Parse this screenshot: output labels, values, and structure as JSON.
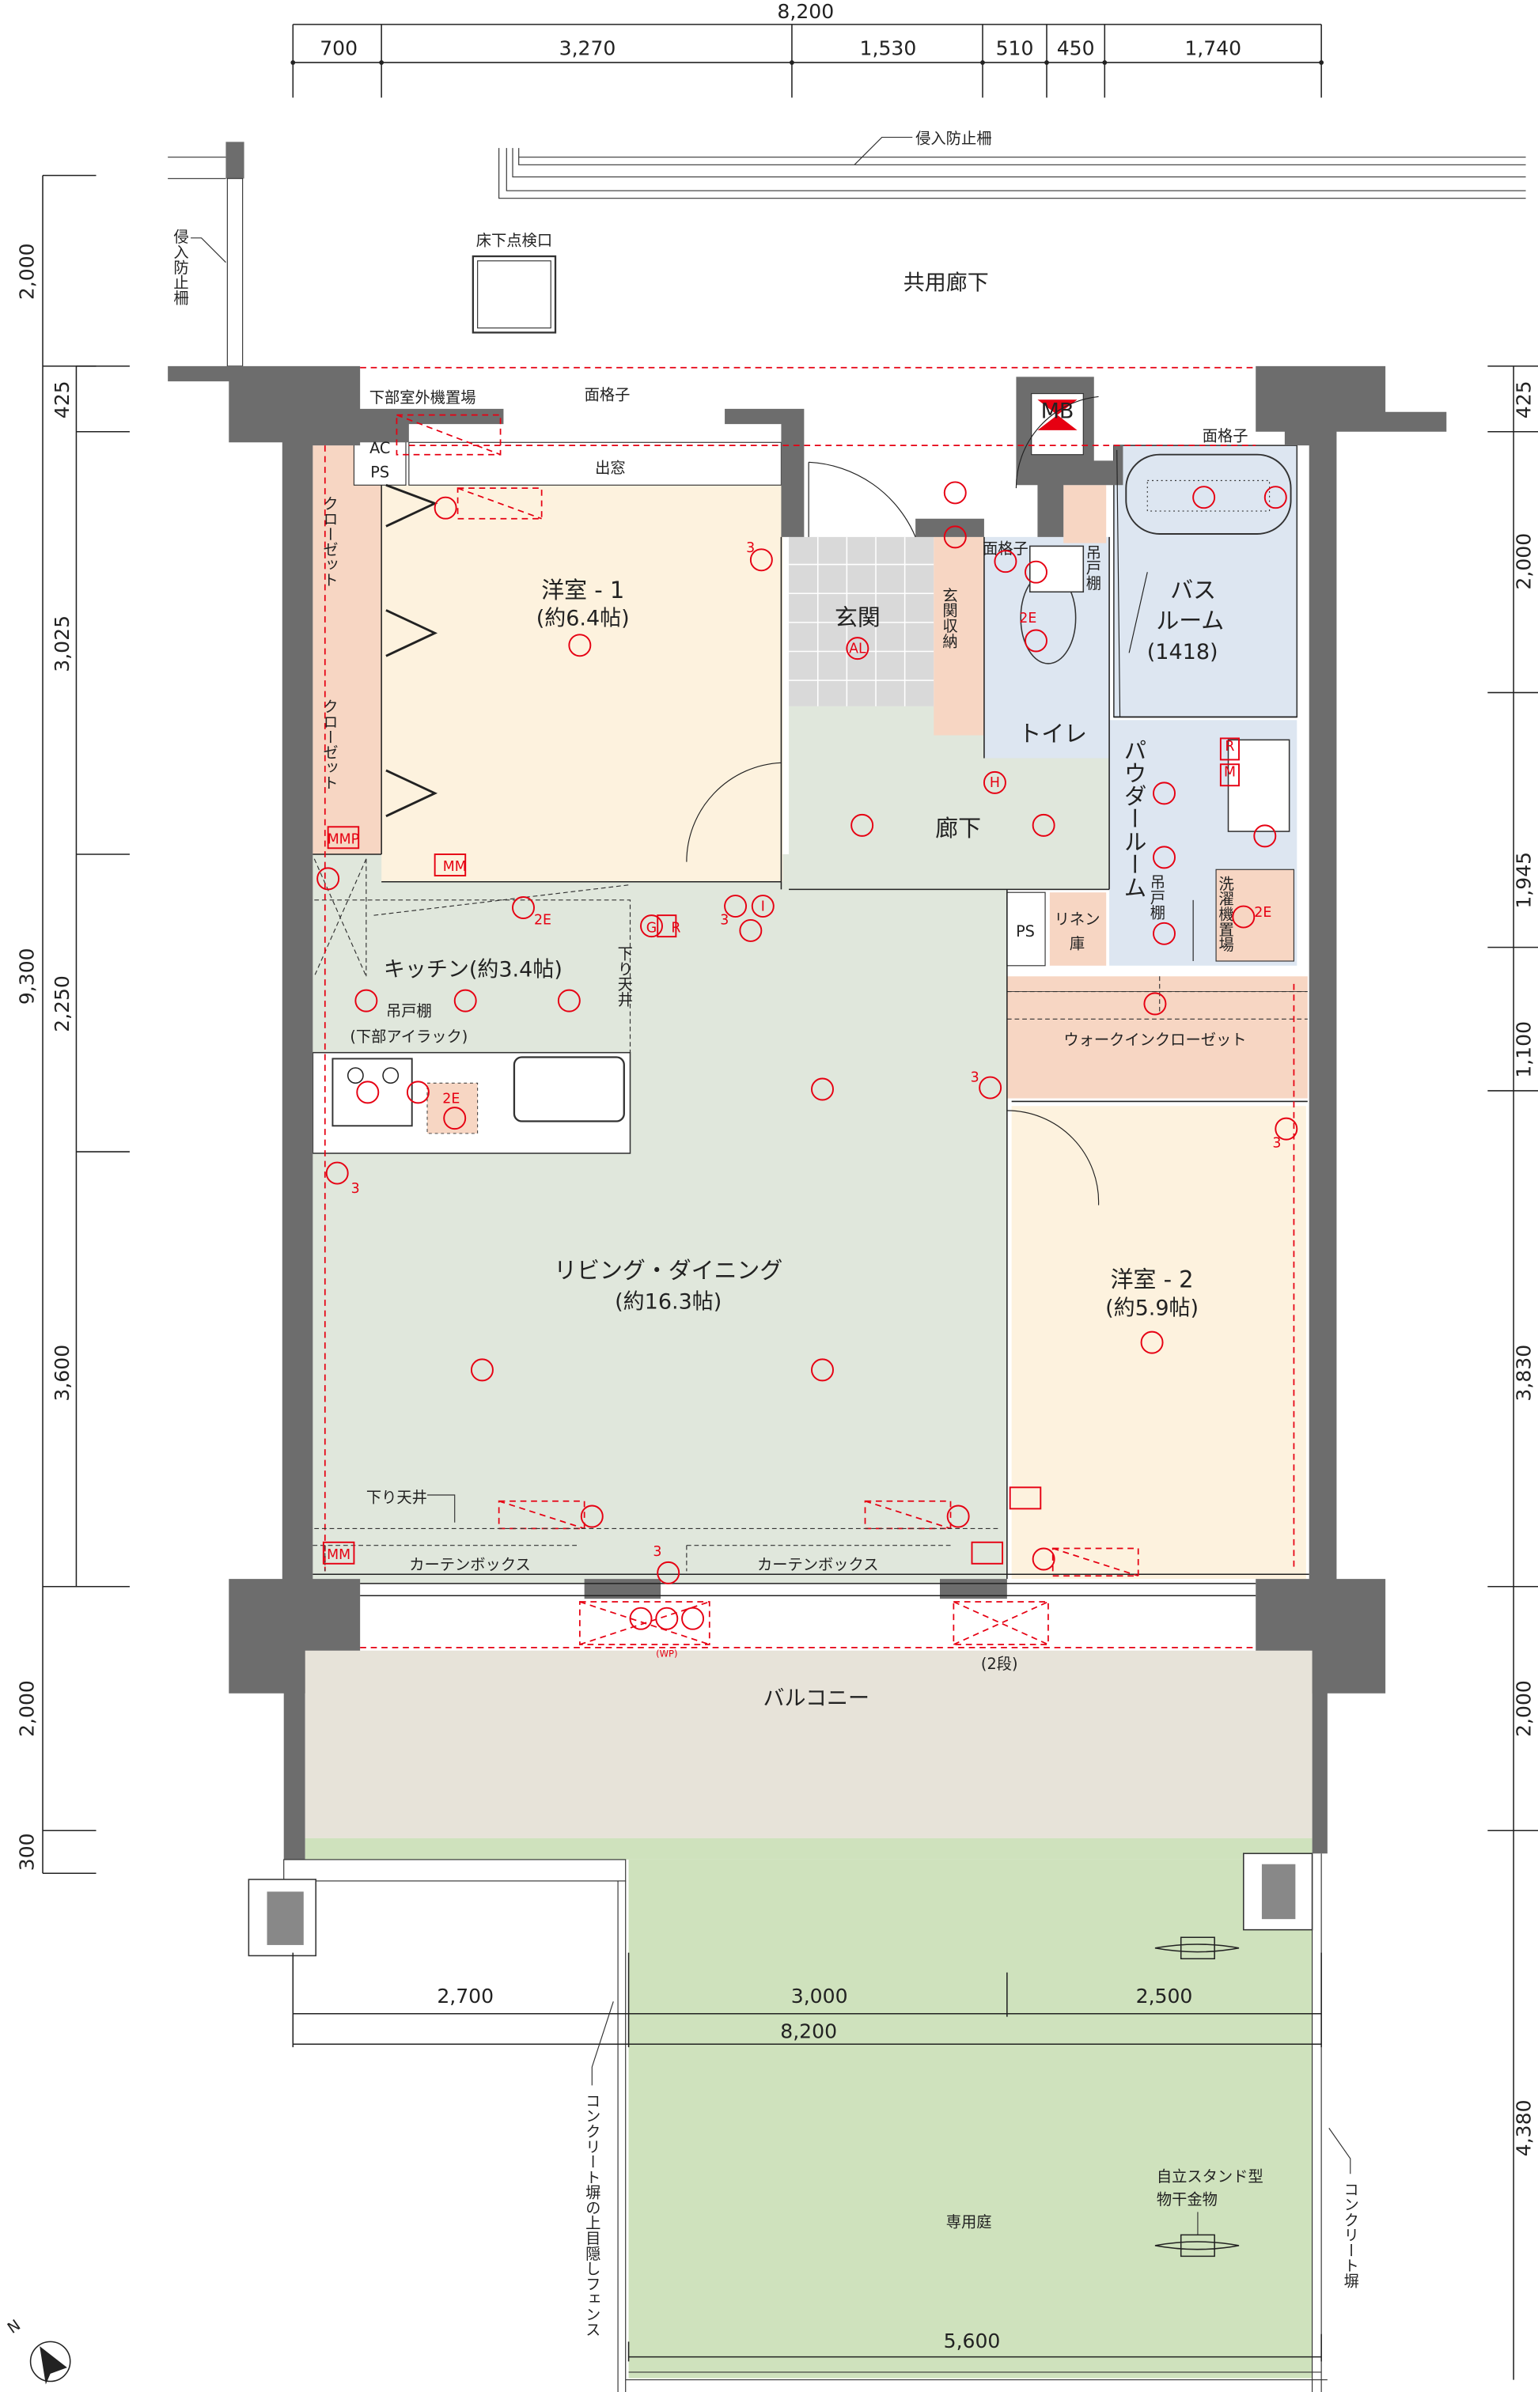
{
  "dimensions": {
    "top_total": "8,200",
    "top_segments": [
      "700",
      "3,270",
      "1,530",
      "510",
      "450",
      "1,740"
    ],
    "left_outer": [
      "2,000",
      "9,300",
      "2,000",
      "300"
    ],
    "left_inner": [
      "425",
      "3,025",
      "2,250",
      "3,600"
    ],
    "right": [
      "425",
      "2,000",
      "1,945",
      "1,100",
      "3,830",
      "2,000",
      "4,380"
    ],
    "garden_segments": [
      "2,700",
      "3,000",
      "2,500"
    ],
    "garden_total": "8,200",
    "garden_width": "5,600"
  },
  "exterior": {
    "common_corridor": "共用廊下",
    "underfloor_hatch": "床下点検口",
    "intrusion_fence_top": "侵入防止柵",
    "intrusion_fence_left": "侵入防止柵",
    "outdoor_unit_space": "下部室外機置場",
    "grille_1": "面格子",
    "grille_2": "面格子",
    "grille_3": "面格子",
    "mb": "MB",
    "ac_ps": [
      "AC",
      "PS"
    ]
  },
  "rooms": {
    "western1": {
      "name": "洋室 - 1",
      "size": "(約6.4帖)"
    },
    "bay_window": "出窓",
    "closet_upper": "クローゼット",
    "closet_lower": "クローゼット",
    "entrance": "玄関",
    "entrance_storage": "玄関収納",
    "hallway": "廊下",
    "toilet": "トイレ",
    "toilet_cabinet": "吊戸棚",
    "bathroom": {
      "line1": "バス",
      "line2": "ルーム",
      "size": "(1418)"
    },
    "powder_room": "パウダールーム",
    "laundry_cabinet": "吊戸棚",
    "laundry_space": "洗濯機置場",
    "ps": "PS",
    "linen": [
      "リネン",
      "庫"
    ],
    "kitchen": "キッチン(約3.4帖)",
    "kitchen_cabinet": [
      "吊戸棚",
      "(下部アイラック)"
    ],
    "dropped_ceiling_1": "下り天井",
    "dropped_ceiling_2": "下り天井",
    "walk_in_closet": "ウォークインクローゼット",
    "living_dining": {
      "name": "リビング・ダイニング",
      "size": "(約16.3帖)"
    },
    "western2": {
      "name": "洋室 - 2",
      "size": "(約5.9帖)"
    },
    "curtain_box_1": "カーテンボックス",
    "curtain_box_2": "カーテンボックス",
    "balcony": "バルコニー",
    "two_tier": "(2段)",
    "private_garden": "専用庭",
    "drying_stand": [
      "自立スタンド型",
      "物干金物"
    ],
    "fence_left": "コンクリート塀の上目隠しフェンス",
    "fence_right": "コンクリート塀"
  },
  "symbols": {
    "al": "AL",
    "h": "H",
    "g": "G",
    "r": "R",
    "i": "I",
    "m": "M",
    "mm": "MM",
    "mmp": "MMP",
    "e2": "2E",
    "three": "3",
    "wp": "(WP)"
  },
  "colors": {
    "wall": "#6d6d6d",
    "bedroom": "#fdf2de",
    "living": "#e0e7dc",
    "wet_area": "#dde6f1",
    "storage": "#f7d6c3",
    "entrance_tile": "#d9d9d9",
    "balcony": "#e7e3d9",
    "garden": "#cfe2bd",
    "fixture_red": "#e60012"
  },
  "compass": "N"
}
